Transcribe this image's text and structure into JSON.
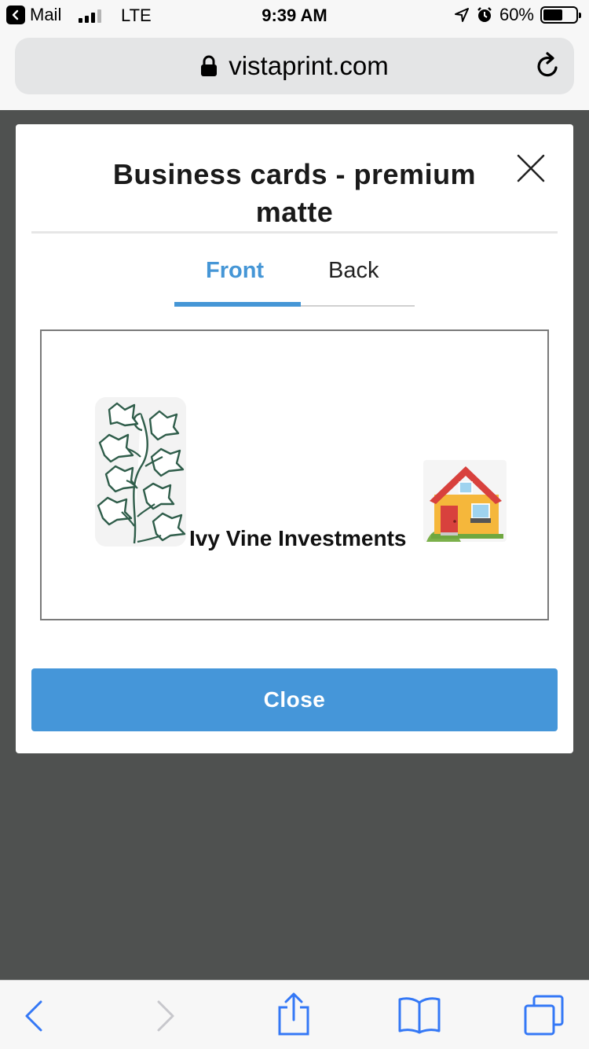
{
  "status_bar": {
    "back_app": "Mail",
    "carrier": "LTE",
    "time": "9:39 AM",
    "battery": "60%",
    "battery_level": 0.6
  },
  "browser": {
    "url": "vistaprint.com"
  },
  "modal": {
    "title": "Business cards - premium matte",
    "tabs": [
      {
        "label": "Front",
        "active": true
      },
      {
        "label": "Back",
        "active": false
      }
    ],
    "card": {
      "company_name": "Ivy Vine Investments"
    },
    "close_button_label": "Close"
  },
  "colors": {
    "accent": "#4596d6",
    "backdrop": "#4f5150",
    "toolbar_icon": "#3478f6"
  },
  "icons": [
    "back-chevron-icon",
    "signal-icon",
    "location-arrow-icon",
    "alarm-icon",
    "battery-icon",
    "lock-icon",
    "reload-icon",
    "close-icon",
    "ivy-icon",
    "house-icon",
    "share-icon",
    "bookmarks-icon",
    "tabs-icon"
  ]
}
